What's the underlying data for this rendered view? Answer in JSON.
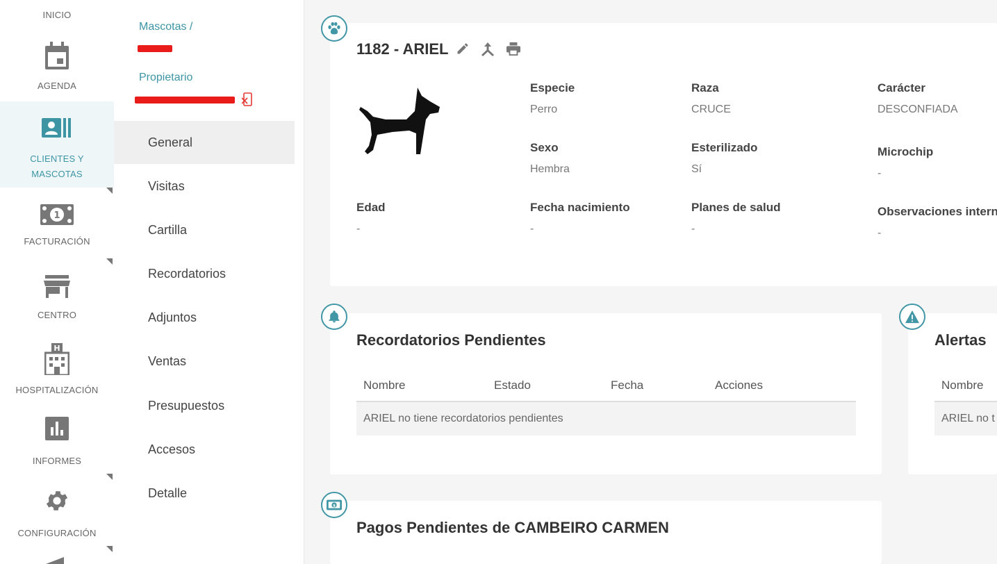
{
  "rail": {
    "items": [
      {
        "label": "INICIO",
        "icon": "home-icon"
      },
      {
        "label": "AGENDA",
        "icon": "calendar-icon"
      },
      {
        "label_line1": "CLIENTES Y",
        "label_line2": "MASCOTAS",
        "icon": "contact-card-icon"
      },
      {
        "label": "FACTURACIÓN",
        "icon": "money-icon"
      },
      {
        "label": "CENTRO",
        "icon": "store-icon"
      },
      {
        "label": "HOSPITALIZACIÓN",
        "icon": "hospital-icon"
      },
      {
        "label": "INFORMES",
        "icon": "bar-chart-icon"
      },
      {
        "label": "CONFIGURACIÓN",
        "icon": "gear-icon"
      }
    ],
    "accent": "#3d95a4"
  },
  "submenu": {
    "breadcrumb": "Mascotas /",
    "owner_label": "Propietario",
    "items": [
      "General",
      "Visitas",
      "Cartilla",
      "Recordatorios",
      "Adjuntos",
      "Ventas",
      "Presupuestos",
      "Accesos",
      "Detalle"
    ],
    "active": "General"
  },
  "pet": {
    "title": "1182 - ARIEL",
    "fields": {
      "especie": {
        "label": "Especie",
        "value": "Perro"
      },
      "raza": {
        "label": "Raza",
        "value": "CRUCE"
      },
      "caracter": {
        "label": "Carácter",
        "value": "DESCONFIADA"
      },
      "sexo": {
        "label": "Sexo",
        "value": "Hembra"
      },
      "esterilizado": {
        "label": "Esterilizado",
        "value": "Sí"
      },
      "microchip": {
        "label": "Microchip",
        "value": "-"
      },
      "edad": {
        "label": "Edad",
        "value": "-"
      },
      "nacimiento": {
        "label": "Fecha nacimiento",
        "value": "-"
      },
      "planes": {
        "label": "Planes de salud",
        "value": "-"
      },
      "observaciones": {
        "label": "Observaciones internas",
        "value": "-"
      }
    }
  },
  "reminders": {
    "title": "Recordatorios Pendientes",
    "columns": [
      "Nombre",
      "Estado",
      "Fecha",
      "Acciones"
    ],
    "empty": "ARIEL no tiene recordatorios pendientes"
  },
  "alerts": {
    "title": "Alertas",
    "column": "Nombre",
    "empty": "ARIEL no t"
  },
  "payments": {
    "title": "Pagos Pendientes de CAMBEIRO CARMEN"
  }
}
